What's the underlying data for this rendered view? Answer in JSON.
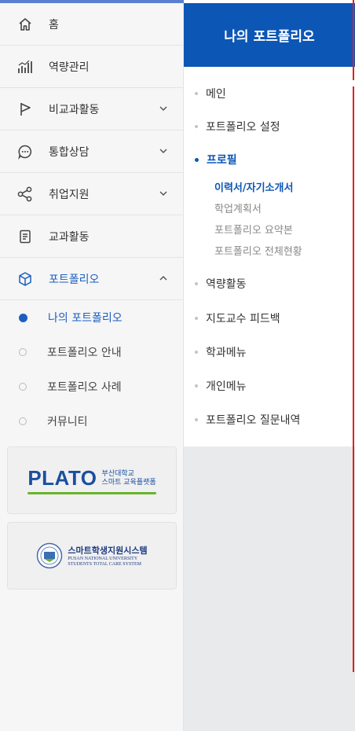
{
  "sidebar": {
    "items": [
      {
        "label": "홈",
        "icon": "home-icon"
      },
      {
        "label": "역량관리",
        "icon": "chart-bars-icon"
      },
      {
        "label": "비교과활동",
        "icon": "flag-icon"
      },
      {
        "label": "통합상담",
        "icon": "chat-bubble-icon"
      },
      {
        "label": "취업지원",
        "icon": "share-icon"
      },
      {
        "label": "교과활동",
        "icon": "document-icon"
      },
      {
        "label": "포트폴리오",
        "icon": "cube-icon"
      }
    ],
    "sub_items": [
      {
        "label": "나의 포트폴리오"
      },
      {
        "label": "포트폴리오 안내"
      },
      {
        "label": "포트폴리오 사례"
      },
      {
        "label": "커뮤니티"
      }
    ],
    "plato_banner": {
      "logo": "PLATO",
      "line1": "부산대학교",
      "line2": "스마트 교육플랫폼"
    },
    "smart_banner": {
      "title": "스마트학생지원시스템",
      "line1": "PUSAN NATIONAL UNIVERSITY",
      "line2": "STUDENTS TOTAL CARE SYSTEM"
    }
  },
  "panel": {
    "title": "나의 포트폴리오",
    "menu": [
      {
        "label": "메인"
      },
      {
        "label": "포트폴리오 설정"
      },
      {
        "label": "프로필"
      },
      {
        "label": "역량활동"
      },
      {
        "label": "지도교수 피드백"
      },
      {
        "label": "학과메뉴"
      },
      {
        "label": "개인메뉴"
      },
      {
        "label": "포트폴리오 질문내역"
      }
    ],
    "profile_sub": [
      {
        "label": "이력서/자기소개서"
      },
      {
        "label": "학업계획서"
      },
      {
        "label": "포트폴리오 요약본"
      },
      {
        "label": "포트폴리오 전체현황"
      }
    ]
  },
  "colors": {
    "accent": "#0c56b6",
    "active_text": "#1c5fbf",
    "green": "#6bb32e",
    "red_marker": "#e02020"
  }
}
